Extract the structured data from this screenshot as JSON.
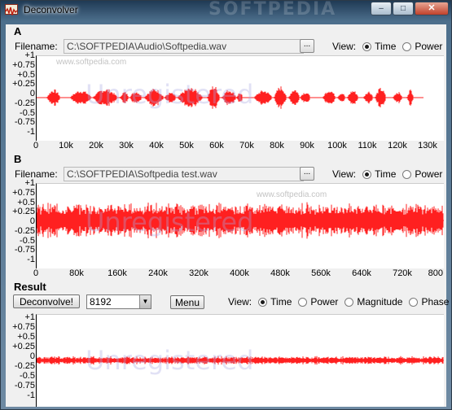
{
  "window": {
    "title": "Deconvolver",
    "watermark": "SOFTPEDIA",
    "buttons": {
      "minimize": "–",
      "maximize": "□",
      "close": "✕"
    }
  },
  "colors": {
    "signal": "#ff2020",
    "plot_bg": "#ffffff",
    "watermark": "#b4b4e6"
  },
  "common": {
    "filename_label": "Filename:",
    "browse_label": "...",
    "view_label": "View:",
    "registered_watermark": "Unregistered",
    "softpedia_mark": "www.softpedia.com"
  },
  "sectionA": {
    "label": "A",
    "filename": "C:\\SOFTPEDIA\\Audio\\Softpedia.wav",
    "view_options": [
      "Time",
      "Power"
    ],
    "view_selected": "Time",
    "y_ticks": [
      "+1",
      "+0.75",
      "+0.5",
      "+0.25",
      "0",
      "-0.25",
      "-0.5",
      "-0.75",
      "-1"
    ],
    "x_ticks": [
      "0",
      "10k",
      "20k",
      "30k",
      "40k",
      "50k",
      "60k",
      "70k",
      "80k",
      "90k",
      "100k",
      "110k",
      "120k",
      "130k"
    ]
  },
  "sectionB": {
    "label": "B",
    "filename": "C:\\SOFTPEDIA\\Softpedia test.wav",
    "view_options": [
      "Time",
      "Power"
    ],
    "view_selected": "Time",
    "y_ticks": [
      "+1",
      "+0.75",
      "+0.5",
      "+0.25",
      "0",
      "-0.25",
      "-0.5",
      "-0.75",
      "-1"
    ],
    "x_ticks": [
      "0",
      "80k",
      "160k",
      "240k",
      "320k",
      "400k",
      "480k",
      "560k",
      "640k",
      "720k",
      "800"
    ]
  },
  "result": {
    "label": "Result",
    "deconvolve_label": "Deconvolve!",
    "fft_size": "8192",
    "menu_label": "Menu",
    "view_options": [
      "Time",
      "Power",
      "Magnitude",
      "Phase"
    ],
    "view_selected": "Time",
    "y_ticks": [
      "+1",
      "+0.75",
      "+0.5",
      "+0.25",
      "0",
      "-0.25",
      "-0.5",
      "-0.75",
      "-1"
    ]
  }
}
